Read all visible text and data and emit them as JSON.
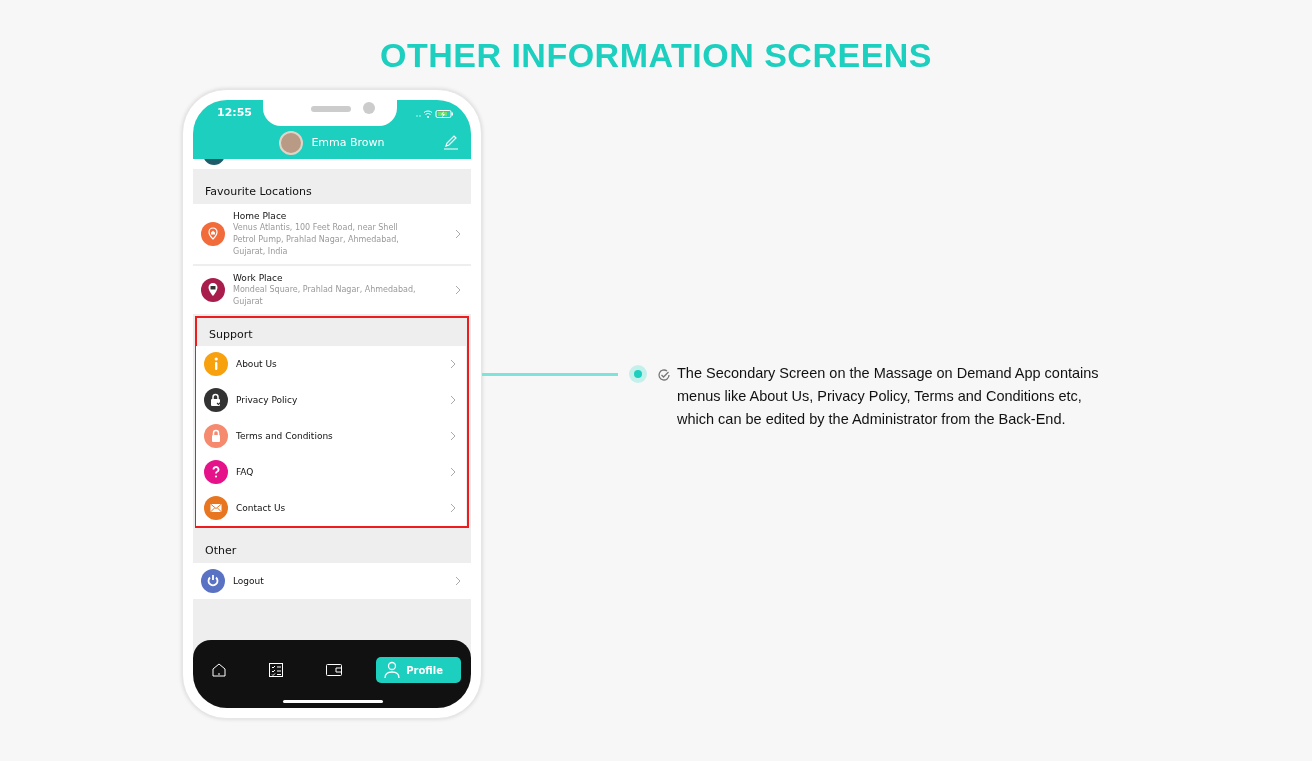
{
  "heading": "OTHER INFORMATION SCREENS",
  "phone": {
    "status_time": "12:55",
    "user_name": "Emma Brown",
    "sections": [
      {
        "title": "Favourite Locations",
        "highlighted": false,
        "items": [
          {
            "title": "Home Place",
            "subtitle": "Venus Atlantis, 100 Feet Road, near Shell Petrol Pump, Prahlad Nagar, Ahmedabad, Gujarat, India",
            "color": "#f26b3a"
          },
          {
            "title": "Work Place",
            "subtitle": "Mondeal Square, Prahlad Nagar, Ahmedabad, Gujarat",
            "color": "#a81d4b"
          }
        ]
      },
      {
        "title": "Support",
        "highlighted": true,
        "items": [
          {
            "title": "About Us",
            "color": "#f7a10f"
          },
          {
            "title": "Privacy Policy",
            "color": "#333333"
          },
          {
            "title": "Terms and Conditions",
            "color": "#f58a6e"
          },
          {
            "title": "FAQ",
            "color": "#e5128a"
          },
          {
            "title": "Contact Us",
            "color": "#e87520"
          }
        ]
      },
      {
        "title": "Other",
        "highlighted": false,
        "items": [
          {
            "title": "Logout",
            "color": "#5a72c4"
          }
        ]
      }
    ],
    "nav": [
      {
        "selected": false
      },
      {
        "selected": false
      },
      {
        "selected": false
      },
      {
        "label": "Profile",
        "selected": true
      }
    ]
  },
  "callout": {
    "text": "The Secondary Screen on the Massage on Demand App contains menus like About Us, Privacy Policy, Terms and Conditions etc, which can be edited by the Administrator from the Back-End."
  }
}
